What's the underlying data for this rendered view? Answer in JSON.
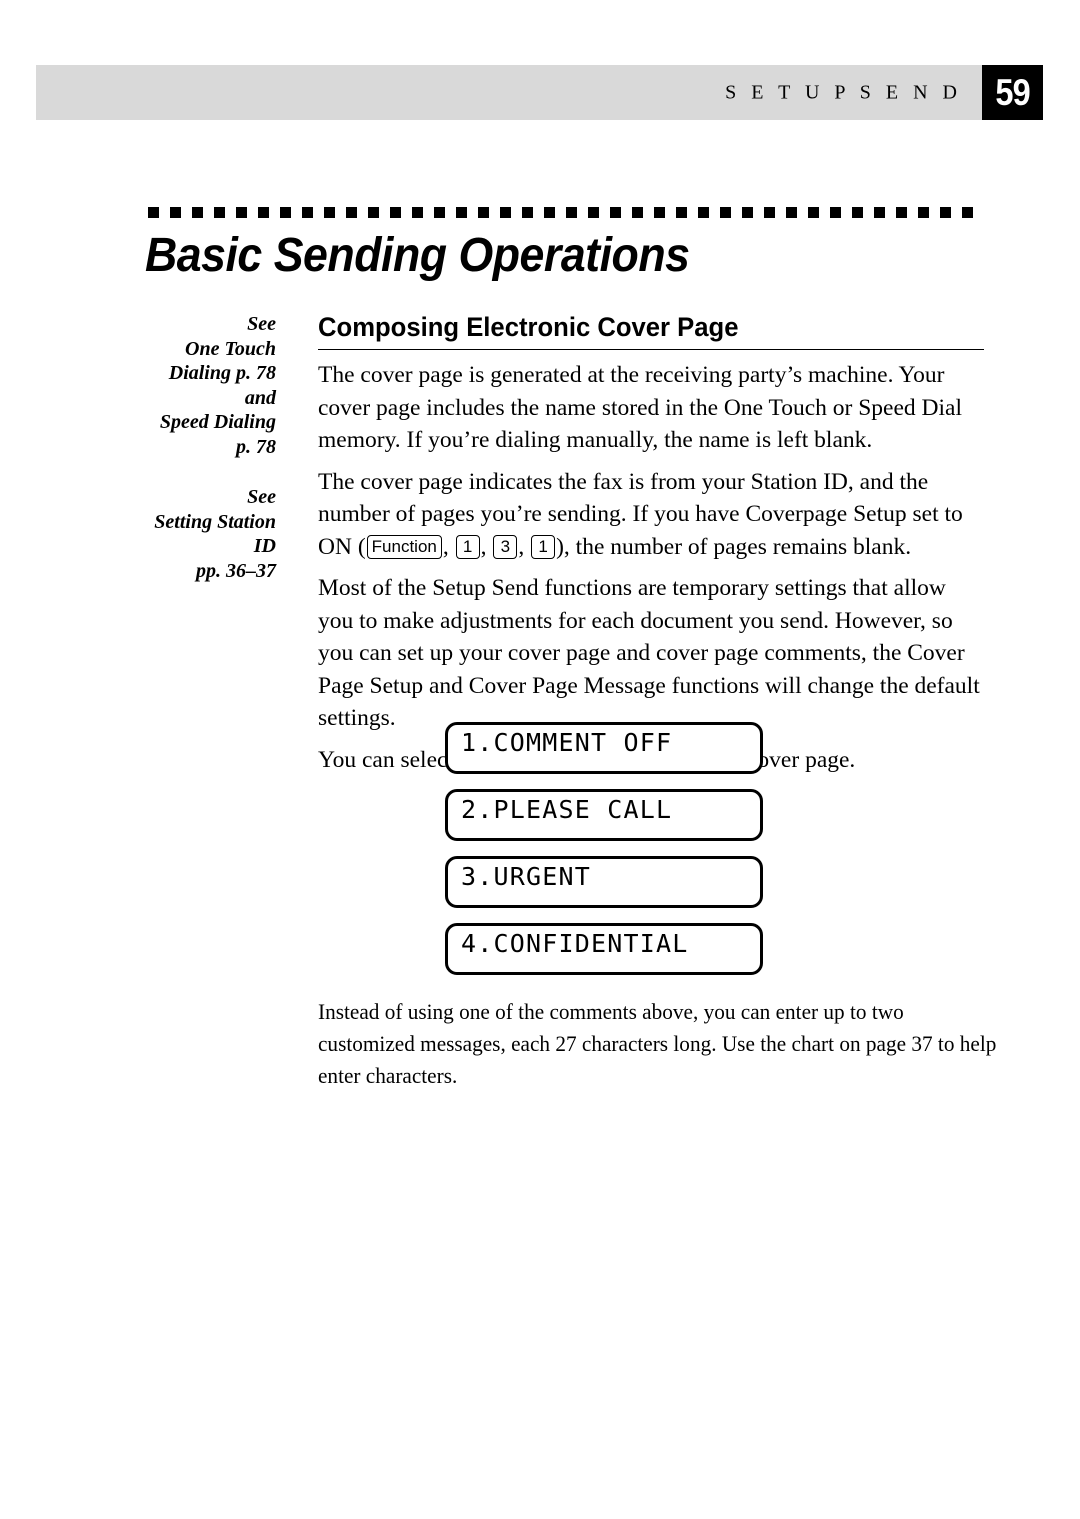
{
  "page": {
    "running_title": "S E T U P  S E N D",
    "page_number": "59",
    "chapter_title": "Basic Sending Operations"
  },
  "sidenotes": [
    {
      "id": "one-touch-speed-dialing",
      "lines": [
        "See",
        "One Touch",
        "Dialing p. 78",
        "and",
        "Speed Dialing",
        "p. 78"
      ]
    },
    {
      "id": "setting-station-id",
      "lines": [
        "See",
        "Setting Station",
        "ID",
        "pp. 36–37"
      ]
    }
  ],
  "section": {
    "heading": "Composing Electronic Cover Page",
    "paragraphs": {
      "p1": "The cover page is generated at the receiving party’s machine. Your cover page includes the name stored in the One Touch or Speed Dial memory. If you’re dialing manually, the name is left blank.",
      "p2_part1": "The cover page indicates the fax is from your Station ID, and the number of pages you’re sending. If you have Coverpage Setup set to ON (",
      "p2_part2": "), the number of pages remains blank.",
      "p3": "Most of the Setup Send functions are temporary settings that allow you to make adjustments for each document you send. However, so you can set up your cover page and cover page comments, the Cover Page Setup and Cover Page Message functions will change the default settings.",
      "p4": "You can select a comment to include on your cover page.",
      "p5": "Instead of using one of the comments above, you can enter up to two customized messages, each 27 characters long. Use the chart on page 37 to help enter characters."
    },
    "keys": {
      "function": "Function",
      "key1": "1",
      "key3": "3",
      "key1b": "1",
      "sep": ", "
    }
  },
  "lcd_panels": [
    {
      "text": "1.COMMENT OFF"
    },
    {
      "text": "2.PLEASE CALL"
    },
    {
      "text": "3.URGENT"
    },
    {
      "text": "4.CONFIDENTIAL"
    }
  ],
  "colors": {
    "header_band": "#d9d9d9",
    "page_box": "#000000",
    "page_number_text": "#ffffff",
    "ink": "#000000",
    "paper": "#ffffff"
  }
}
